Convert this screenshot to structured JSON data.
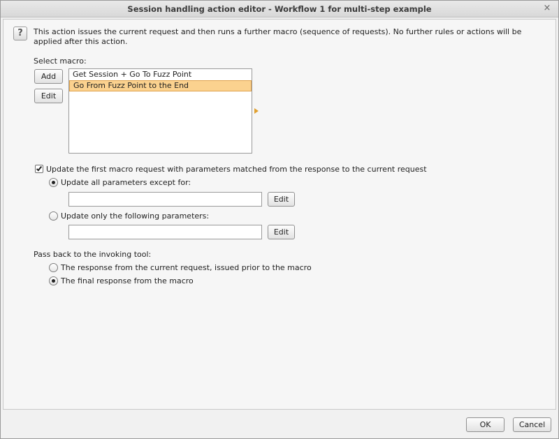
{
  "window": {
    "title": "Session handling action editor - Workflow 1 for multi-step example",
    "close_symbol": "×"
  },
  "help": {
    "symbol": "?"
  },
  "description": "This action issues the current request and then runs a further macro (sequence of requests). No further rules or actions will be applied after this action.",
  "macro": {
    "label": "Select macro:",
    "add_label": "Add",
    "edit_label": "Edit",
    "items": [
      {
        "label": "Get Session + Go To Fuzz Point"
      },
      {
        "label": "Go From Fuzz Point to the End"
      }
    ],
    "selected_item": "Go From Fuzz Point to the End",
    "selection_color": "#fbd28f"
  },
  "update": {
    "checkbox_label": "Update the first macro request with parameters matched from the response to the current request",
    "checked": true,
    "all_except_label": "Update all parameters except for:",
    "all_except_value": "",
    "all_except_edit_label": "Edit",
    "only_following_label": "Update only the following parameters:",
    "only_following_value": "",
    "only_following_edit_label": "Edit",
    "selected_option": "Update all parameters except for:"
  },
  "pass_back": {
    "label": "Pass back to the invoking tool:",
    "option_current": "The response from the current request, issued prior to the macro",
    "option_final": "The final response from the macro",
    "selected_option": "The final response from the macro"
  },
  "footer": {
    "ok_label": "OK",
    "cancel_label": "Cancel"
  }
}
